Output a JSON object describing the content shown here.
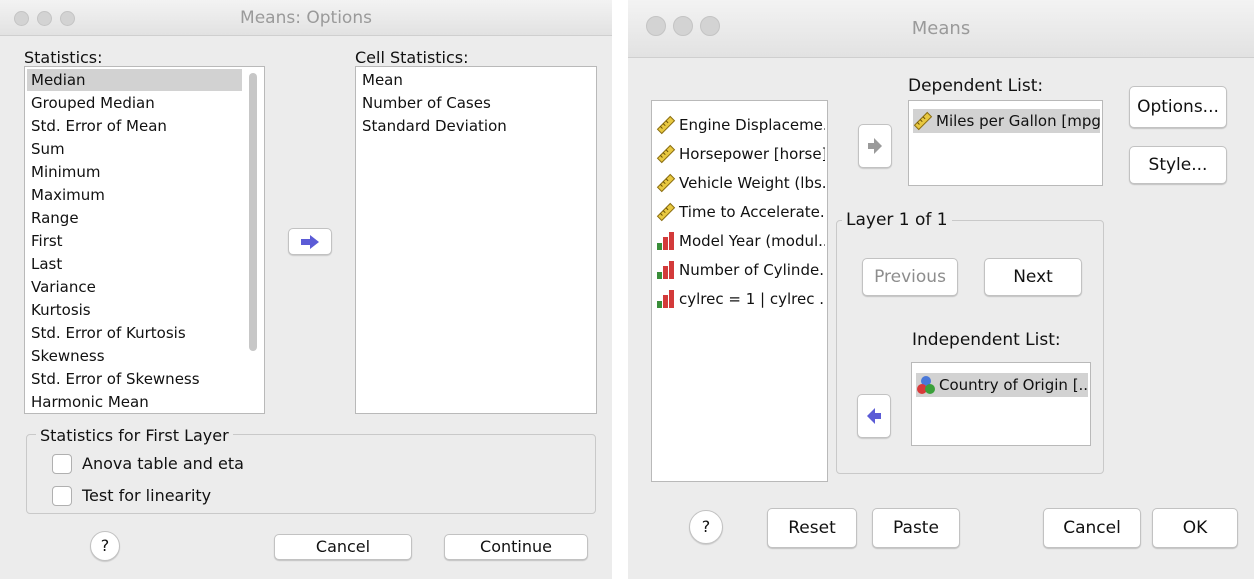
{
  "left": {
    "title": "Means: Options",
    "statistics_label": "Statistics:",
    "statistics": [
      "Median",
      "Grouped Median",
      "Std. Error of Mean",
      "Sum",
      "Minimum",
      "Maximum",
      "Range",
      "First",
      "Last",
      "Variance",
      "Kurtosis",
      "Std. Error of Kurtosis",
      "Skewness",
      "Std. Error of Skewness",
      "Harmonic Mean"
    ],
    "selected_statistic": "Median",
    "cell_statistics_label": "Cell Statistics:",
    "cell_statistics": [
      "Mean",
      "Number of Cases",
      "Standard Deviation"
    ],
    "first_layer_group": "Statistics for First Layer",
    "anova_label": "Anova table and eta",
    "linearity_label": "Test for linearity",
    "help_label": "?",
    "cancel_label": "Cancel",
    "continue_label": "Continue"
  },
  "right": {
    "title": "Means",
    "variables": [
      {
        "label": "Engine Displaceme...",
        "icon": "scale-ruler-icon"
      },
      {
        "label": "Horsepower [horse]",
        "icon": "scale-ruler-icon"
      },
      {
        "label": "Vehicle Weight (lbs...",
        "icon": "scale-ruler-icon"
      },
      {
        "label": "Time to Accelerate...",
        "icon": "scale-ruler-icon"
      },
      {
        "label": "Model Year (modul...",
        "icon": "ordinal-bar-icon"
      },
      {
        "label": "Number of Cylinde...",
        "icon": "ordinal-bar-icon"
      },
      {
        "label": "cylrec = 1 | cylrec ...",
        "icon": "ordinal-bar-icon"
      }
    ],
    "dependent_label": "Dependent List:",
    "dependent_items": [
      "Miles per Gallon [mpg]"
    ],
    "options_label": "Options...",
    "style_label": "Style...",
    "layer_label": "Layer 1 of 1",
    "previous_label": "Previous",
    "next_label": "Next",
    "independent_label": "Independent List:",
    "independent_items": [
      "Country of Origin [..."
    ],
    "help_label": "?",
    "reset_label": "Reset",
    "paste_label": "Paste",
    "cancel_label": "Cancel",
    "ok_label": "OK"
  },
  "colors": {
    "window_bg": "#ececec",
    "selection": "#d2d2d2",
    "arrow": "#5b5bd6"
  }
}
